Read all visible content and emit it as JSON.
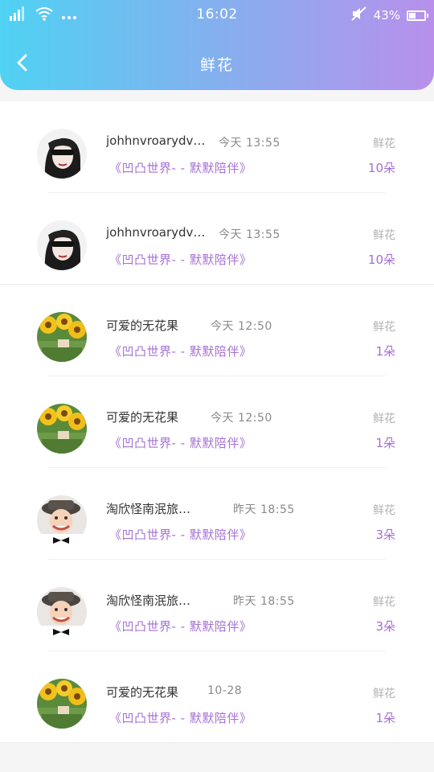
{
  "status_bar": {
    "time": "16:02",
    "battery_text": "43%",
    "battery_level": 0.43,
    "icons": [
      "signal-icon",
      "wifi-icon",
      "more-dots-icon",
      "mute-icon",
      "battery-icon"
    ]
  },
  "header": {
    "title": "鲜花",
    "back_icon": "back-chevron-icon"
  },
  "colors": {
    "header_gradient_start": "#4fd2f3",
    "header_gradient_end": "#b890ec",
    "accent_purple": "#a56fd6"
  },
  "items": [
    {
      "avatar": "avatar-girl-sunglasses",
      "name": "johhnvroarydvatos",
      "time": "今天  13:55",
      "title": "《凹凸世界- - 默默陪伴》",
      "type": "鲜花",
      "count": "10朵"
    },
    {
      "avatar": "avatar-girl-sunglasses",
      "name": "johhnvroarydvatos",
      "time": "今天  13:55",
      "title": "《凹凸世界- - 默默陪伴》",
      "type": "鲜花",
      "count": "10朵"
    },
    {
      "avatar": "avatar-sunflowers",
      "name": "可爱的无花果",
      "time": "今天  12:50",
      "title": "《凹凸世界- - 默默陪伴》",
      "type": "鲜花",
      "count": "1朵"
    },
    {
      "avatar": "avatar-sunflowers",
      "name": "可爱的无花果",
      "time": "今天  12:50",
      "title": "《凹凸世界- - 默默陪伴》",
      "type": "鲜花",
      "count": "1朵"
    },
    {
      "avatar": "avatar-child-hat",
      "name": "淘欣怪南泯旅…",
      "time": "昨天  18:55",
      "title": "《凹凸世界- - 默默陪伴》",
      "type": "鲜花",
      "count": "3朵"
    },
    {
      "avatar": "avatar-child-hat",
      "name": "淘欣怪南泯旅…",
      "time": "昨天  18:55",
      "title": "《凹凸世界- - 默默陪伴》",
      "type": "鲜花",
      "count": "3朵"
    },
    {
      "avatar": "avatar-sunflowers",
      "name": "可爱的无花果",
      "time": "10-28",
      "title": "《凹凸世界- - 默默陪伴》",
      "type": "鲜花",
      "count": "1朵"
    }
  ]
}
